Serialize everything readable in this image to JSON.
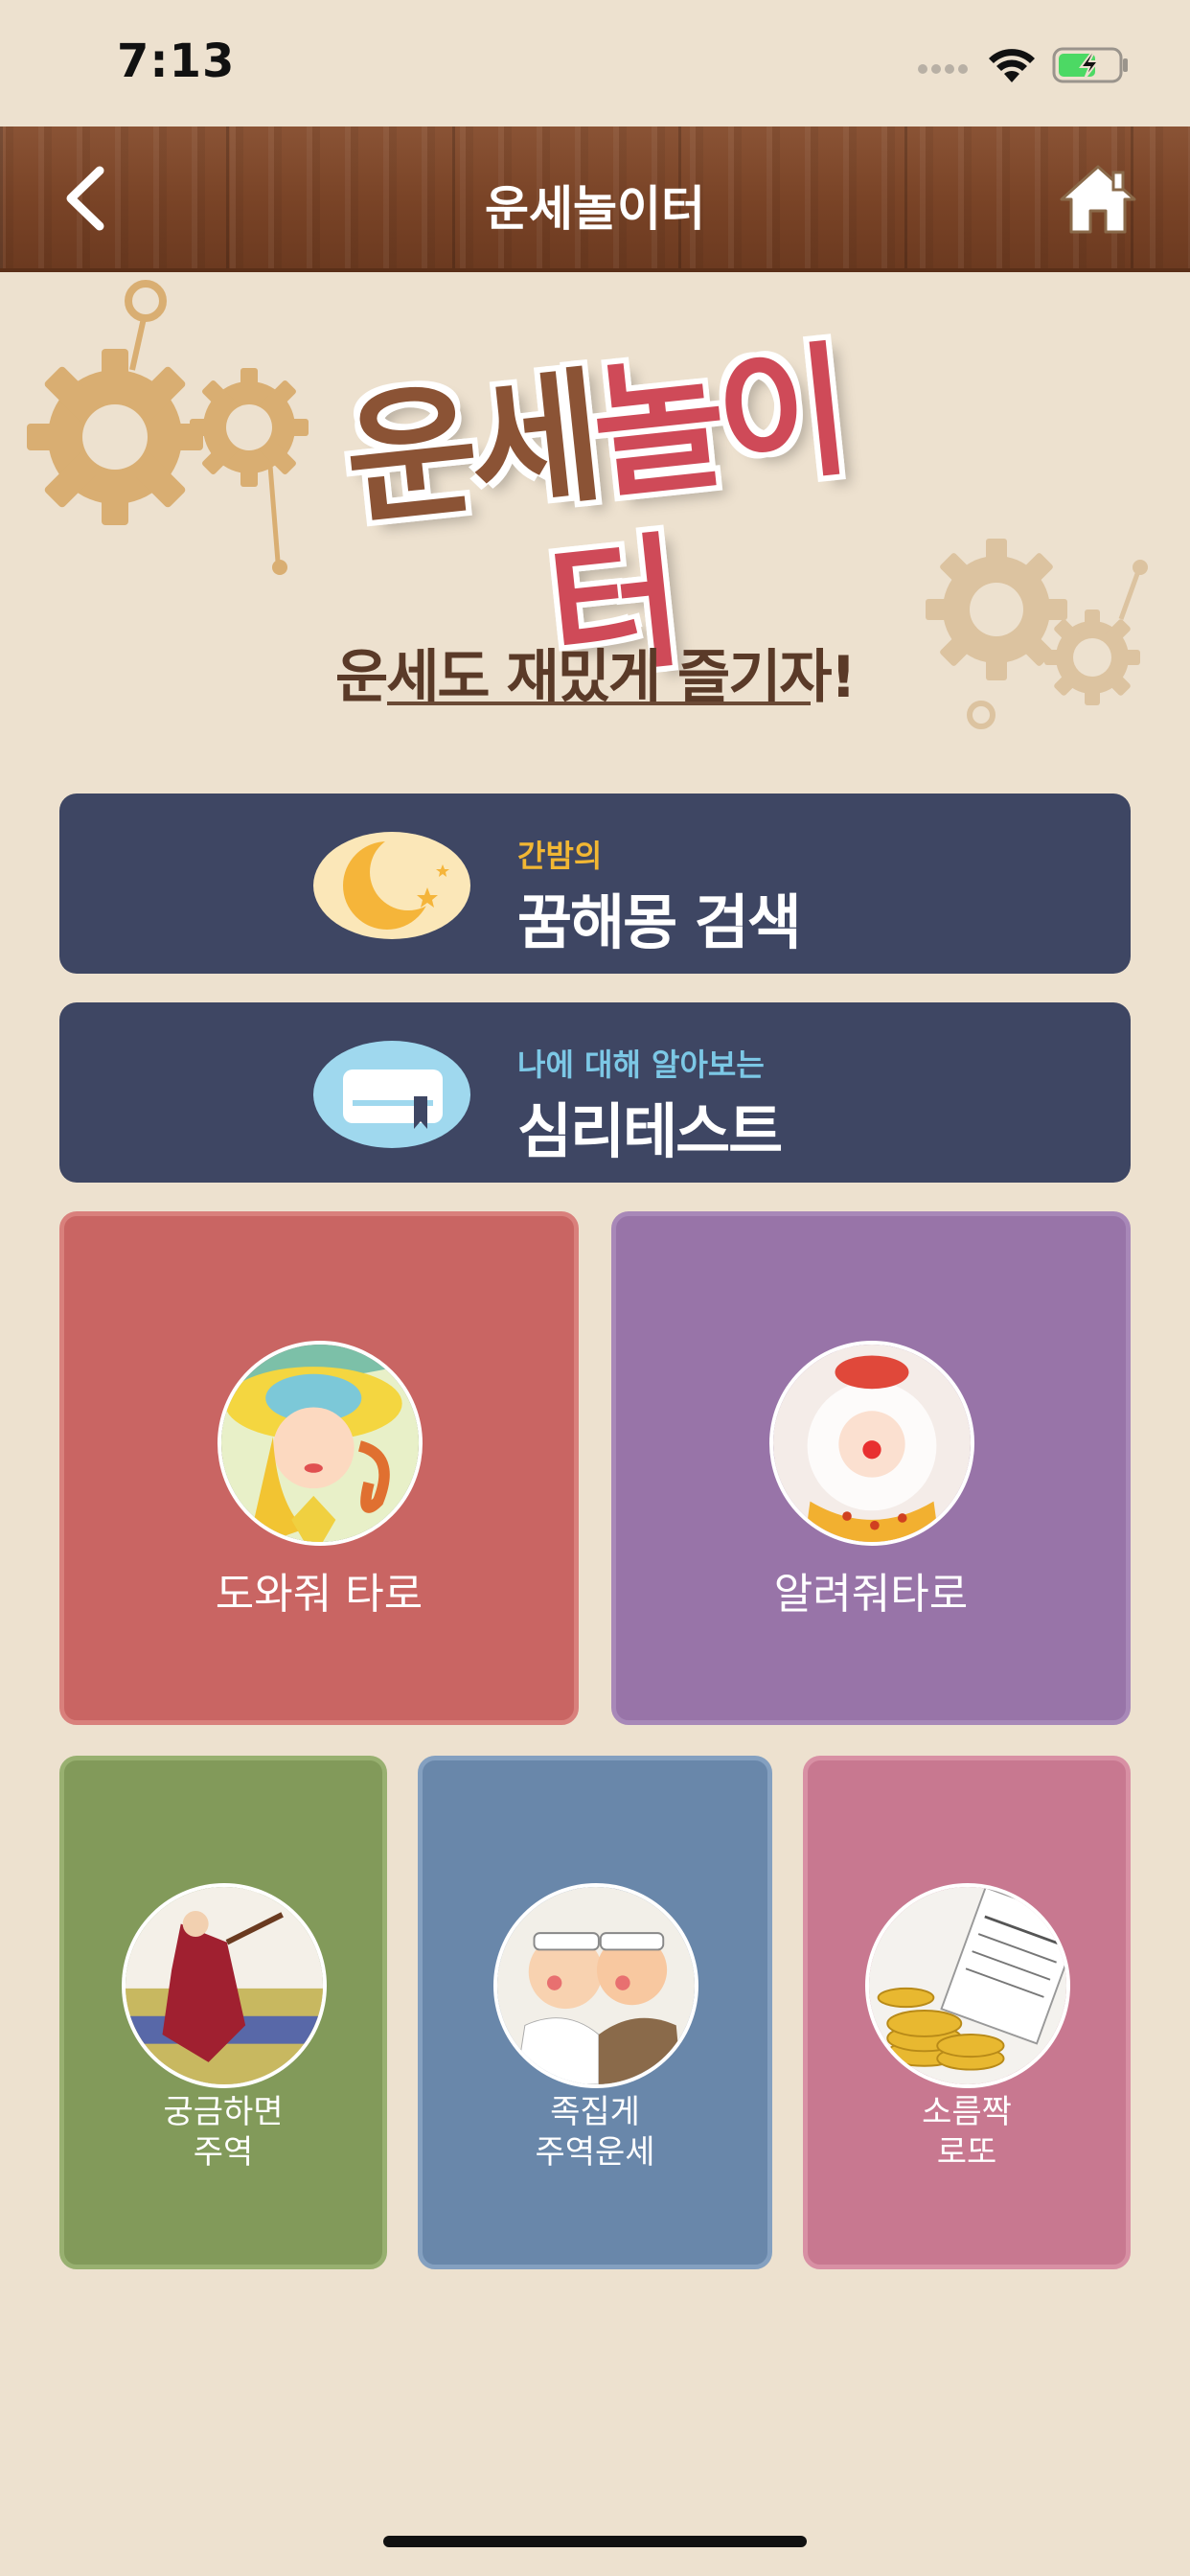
{
  "status_bar": {
    "time": "7:13"
  },
  "nav": {
    "title": "운세놀이터"
  },
  "banner": {
    "logo_part1": "운세",
    "logo_part2": "놀이터",
    "tagline": "운세도 재밌게 즐기자!"
  },
  "menu": {
    "dream": {
      "sub": "간밤의",
      "main": "꿈해몽 검색"
    },
    "psych": {
      "sub": "나에 대해 알아보는",
      "main": "심리테스트"
    }
  },
  "cards": {
    "tarot_help": "도와줘 타로",
    "tarot_tell": "알려줘타로",
    "juyeok": "궁금하면\n주역",
    "jokjip": "족집게\n주역운세",
    "lotto": "소름짝\n로또"
  },
  "colors": {
    "background": "#ede1cf",
    "wide_button": "#3e4663",
    "tarot_help": "#c96563",
    "tarot_tell": "#9874a8",
    "juyeok": "#829a5a",
    "jokjip": "#6987aa",
    "lotto": "#c87890"
  }
}
